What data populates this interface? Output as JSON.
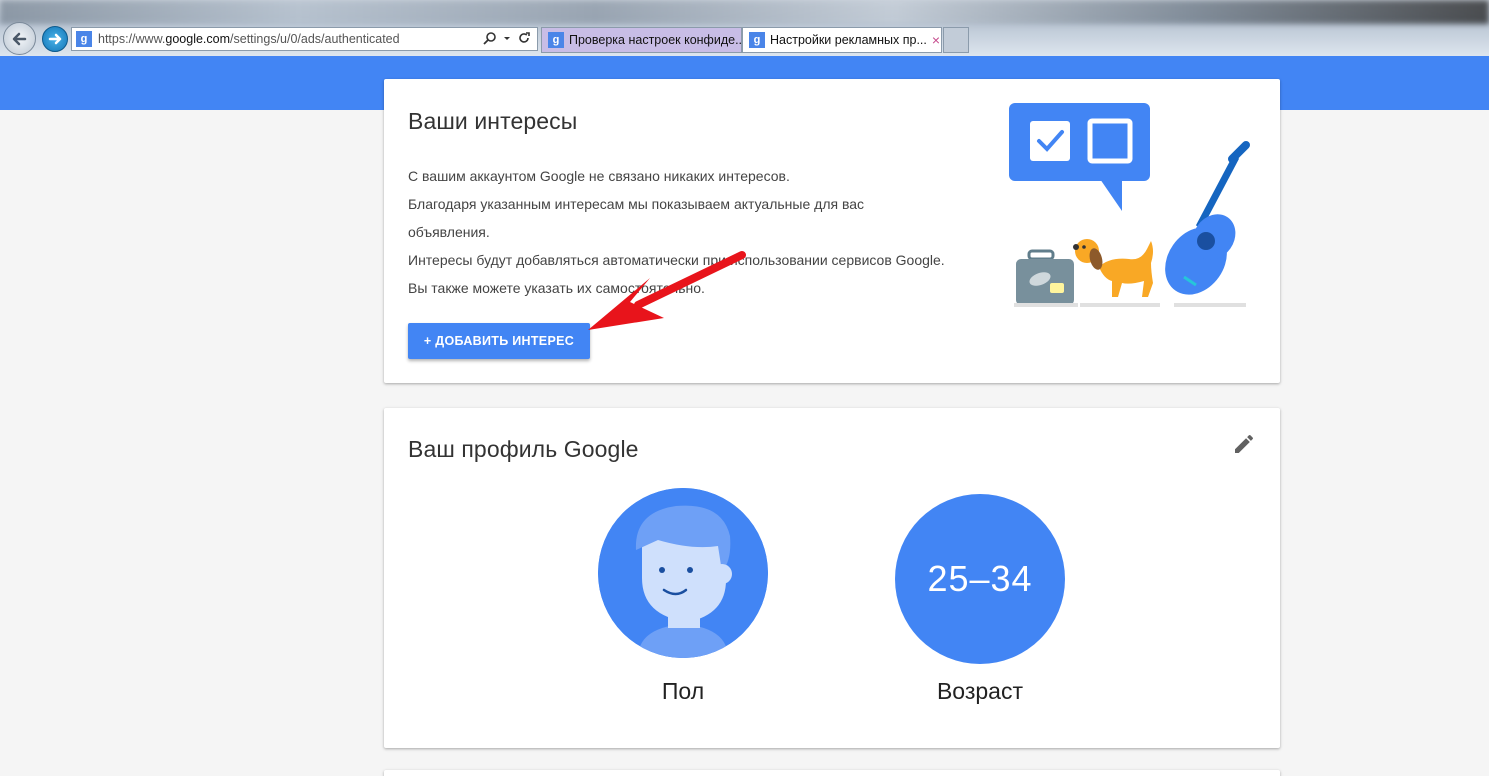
{
  "browser": {
    "url_prefix": "https://www.",
    "url_domain": "google.com",
    "url_path": "/settings/u/0/ads/authenticated",
    "tabs": [
      {
        "label": "Проверка настроек конфиде..."
      },
      {
        "label": "Настройки рекламных пр...",
        "close": "×"
      }
    ],
    "favicon": "g"
  },
  "interests_card": {
    "title": "Ваши интересы",
    "lines": [
      "С вашим аккаунтом Google не связано никаких интересов.",
      "Благодаря указанным интересам мы показываем актуальные для вас объявления.",
      "Интересы будут добавляться автоматически при использовании сервисов Google. Вы также можете указать их самостоятельно."
    ],
    "add_button": "+ ДОБАВИТЬ ИНТЕРЕС"
  },
  "profile_card": {
    "title": "Ваш профиль Google",
    "gender_label": "Пол",
    "age_value": "25–34",
    "age_label": "Возраст"
  },
  "colors": {
    "accent": "#4285f4",
    "annotation_arrow": "#e8141b"
  },
  "icons": [
    "back-arrow-icon",
    "forward-arrow-icon",
    "search-icon",
    "refresh-icon",
    "edit-pencil-icon",
    "checkbox-icon",
    "suitcase-icon",
    "dog-icon",
    "guitar-icon",
    "person-avatar-icon"
  ]
}
